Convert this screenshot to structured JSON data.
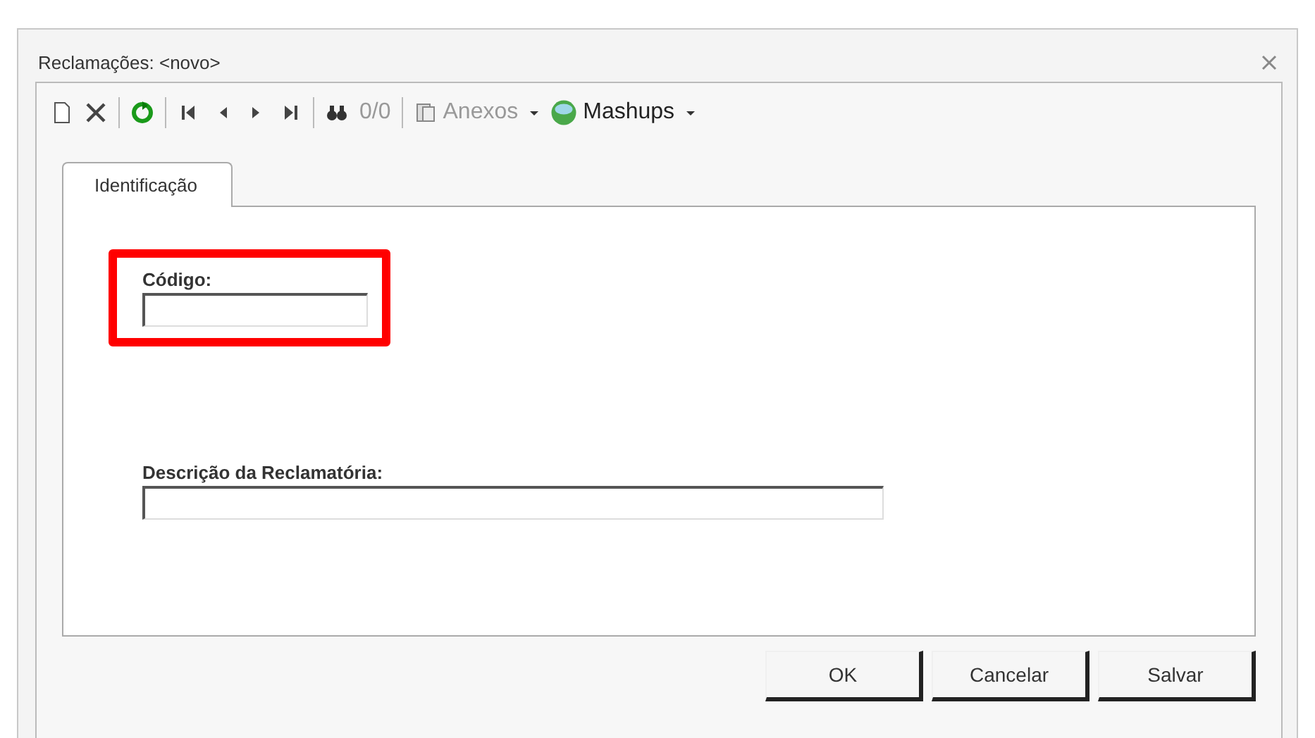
{
  "window": {
    "title": "Reclamações: <novo>"
  },
  "toolbar": [
    {
      "kind": "new"
    },
    {
      "kind": "delete"
    },
    {
      "kind": "sep"
    },
    {
      "kind": "refresh"
    },
    {
      "kind": "sep"
    },
    {
      "kind": "first"
    },
    {
      "kind": "prev"
    },
    {
      "kind": "next"
    },
    {
      "kind": "last"
    },
    {
      "kind": "sep"
    },
    {
      "kind": "find"
    },
    {
      "kind": "counter",
      "label": "0/0",
      "disabled": true
    },
    {
      "kind": "sep"
    },
    {
      "kind": "attach",
      "label": "Anexos",
      "disabled": true
    },
    {
      "kind": "dropdown"
    },
    {
      "kind": "mashups",
      "label": "Mashups",
      "disabled": false
    },
    {
      "kind": "dropdown"
    }
  ],
  "tabs": [
    {
      "label": "Identificação",
      "selected": true
    }
  ],
  "fields": [
    {
      "label": "Código:",
      "highlighted": true,
      "wide": false
    },
    {
      "label": "Descrição da Reclamatória:",
      "highlighted": false,
      "wide": true
    }
  ],
  "buttons": [
    "OK",
    "Cancelar",
    "Salvar"
  ]
}
